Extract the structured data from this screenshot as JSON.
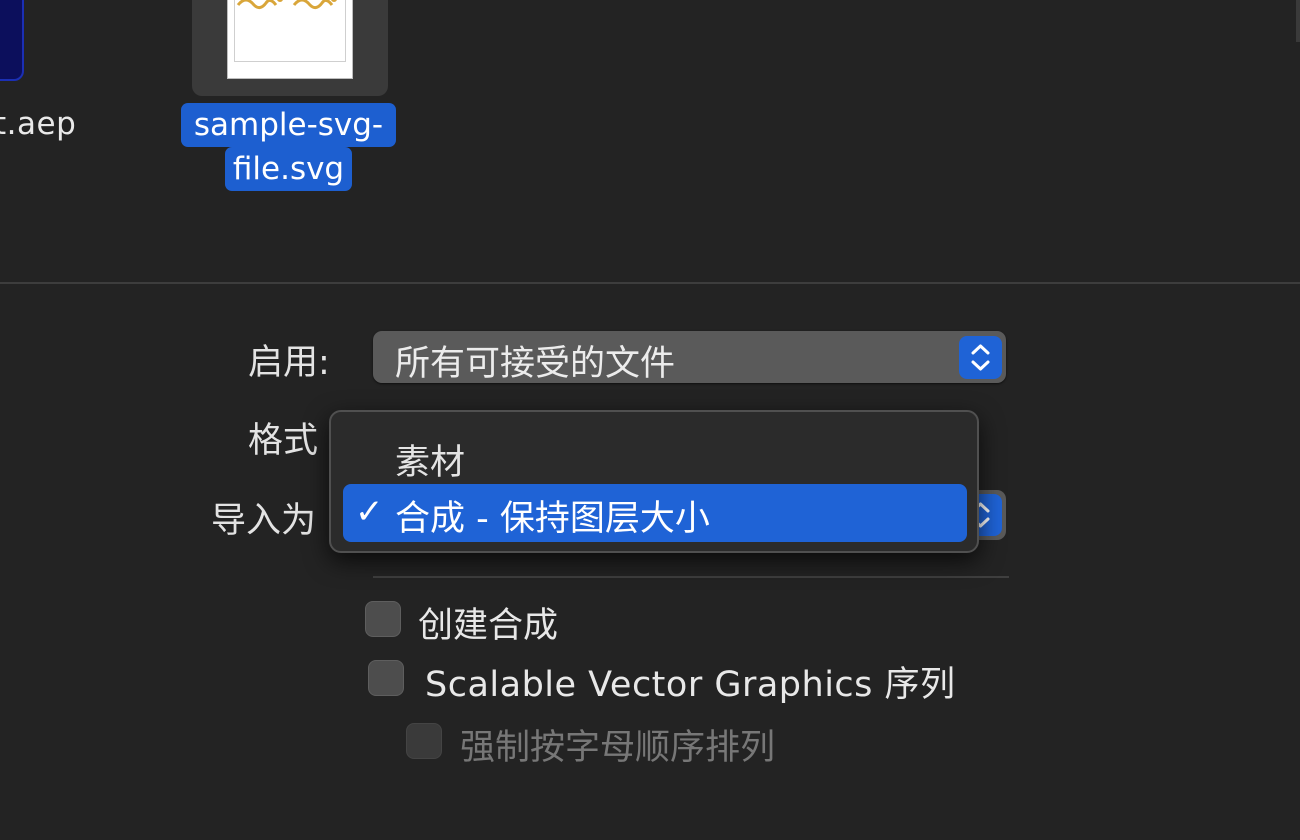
{
  "files": {
    "partial_name": "t.aep",
    "selected_file": {
      "name_line1": "sample-svg-",
      "name_line2": "file.svg"
    }
  },
  "options": {
    "enable": {
      "label": "启用:",
      "value": "所有可接受的文件"
    },
    "format": {
      "label": "格式"
    },
    "import_as": {
      "label": "导入为",
      "menu_items": [
        {
          "label": "素材",
          "selected": false
        },
        {
          "label": "合成 - 保持图层大小",
          "selected": true
        }
      ],
      "check_glyph": "✓"
    },
    "checkboxes": {
      "create_comp": {
        "label": "创建合成",
        "checked": false,
        "enabled": true
      },
      "svg_sequence": {
        "label": "Scalable Vector Graphics 序列",
        "checked": false,
        "enabled": true
      },
      "force_alphabetical": {
        "label": "强制按字母顺序排列",
        "checked": false,
        "enabled": false
      }
    }
  },
  "colors": {
    "background": "#232323",
    "accent": "#1f63d6",
    "selection": "#1d5fd0"
  },
  "icons": {
    "stepper": "up-down-chevron-icon",
    "check": "checkmark-icon"
  }
}
